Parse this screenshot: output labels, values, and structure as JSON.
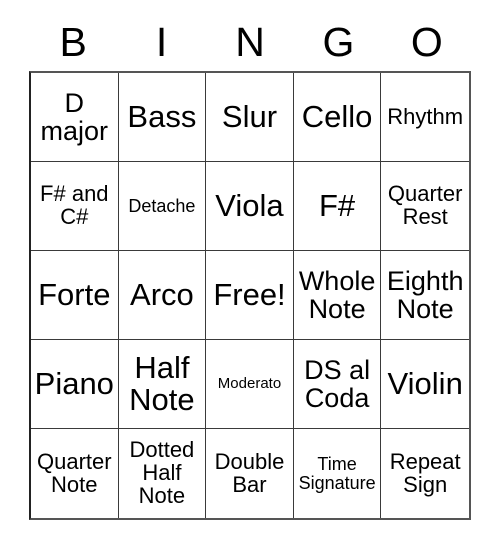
{
  "card": {
    "title": "BINGO",
    "header": {
      "letters": [
        "B",
        "I",
        "N",
        "G",
        "O"
      ]
    },
    "colors": {
      "text": "#000000",
      "grid_line": "#3a3a3a",
      "border": "#555555",
      "background": "#ffffff"
    },
    "grid": {
      "columns": 5,
      "rows": 5,
      "free_space": "Free!",
      "cells": [
        {
          "text": "D\nmajor",
          "size": "lg"
        },
        {
          "text": "Bass",
          "size": "xl"
        },
        {
          "text": "Slur",
          "size": "xl"
        },
        {
          "text": "Cello",
          "size": "xl"
        },
        {
          "text": "Rhythm",
          "size": "md"
        },
        {
          "text": "F# and\nC#",
          "size": "md"
        },
        {
          "text": "Detache",
          "size": "sm"
        },
        {
          "text": "Viola",
          "size": "xl"
        },
        {
          "text": "F#",
          "size": "xl"
        },
        {
          "text": "Quarter\nRest",
          "size": "md"
        },
        {
          "text": "Forte",
          "size": "xl"
        },
        {
          "text": "Arco",
          "size": "xl"
        },
        {
          "text": "Free!",
          "size": "xl"
        },
        {
          "text": "Whole\nNote",
          "size": "lg"
        },
        {
          "text": "Eighth\nNote",
          "size": "lg"
        },
        {
          "text": "Piano",
          "size": "xl"
        },
        {
          "text": "Half\nNote",
          "size": "xl"
        },
        {
          "text": "Moderato",
          "size": "xs"
        },
        {
          "text": "DS al\nCoda",
          "size": "lg"
        },
        {
          "text": "Violin",
          "size": "xl"
        },
        {
          "text": "Quarter\nNote",
          "size": "md"
        },
        {
          "text": "Dotted\nHalf\nNote",
          "size": "md"
        },
        {
          "text": "Double\nBar",
          "size": "md"
        },
        {
          "text": "Time\nSignature",
          "size": "sm"
        },
        {
          "text": "Repeat\nSign",
          "size": "md"
        }
      ]
    }
  }
}
